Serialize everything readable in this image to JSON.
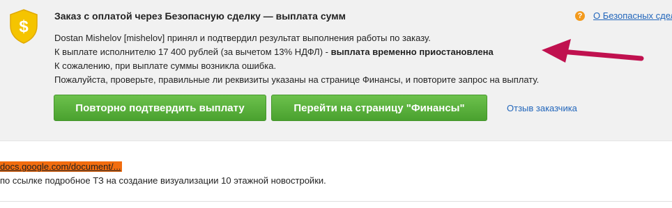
{
  "deal_panel": {
    "title": "Заказ с оплатой через Безопасную сделку — выплата сумм",
    "help_link": "О Безопасных сдел",
    "help_icon_glyph": "?",
    "shield_icon_glyph": "$",
    "message": {
      "line1": "Dostan Mishelov [mishelov] принял и подтвердил результат выполнения работы по заказу.",
      "line2_text": "К выплате исполнителю 17 400 рублей (за вычетом 13% НДФЛ) - ",
      "line2_bold": "выплата временно приостановлена",
      "line3": "К сожалению, при выплате суммы возникла ошибка.",
      "line4": "Пожалуйста, проверьте, правильные ли реквизиты указаны на странице Финансы, и повторите запрос на выплату."
    },
    "buttons": {
      "reconfirm": "Повторно подтвердить выплату",
      "finances": "Перейти на страницу \"Финансы\""
    },
    "review_link": "Отзыв заказчика"
  },
  "attachment": {
    "link": "docs.google.com/document/...",
    "description": "по ссылке подробное ТЗ на создание визуализации 10 этажной новостройки."
  },
  "colors": {
    "panel_bg": "#f1f1f1",
    "button_green": "#5ab33c",
    "link_blue": "#2266bb",
    "shield_yellow": "#f5c400",
    "arrow_magenta": "#c0114f",
    "highlight_orange": "#f26d0f",
    "help_orange": "#f39a1d"
  },
  "icons": [
    "shield-dollar-icon",
    "help-icon",
    "arrow-pointer-icon"
  ]
}
